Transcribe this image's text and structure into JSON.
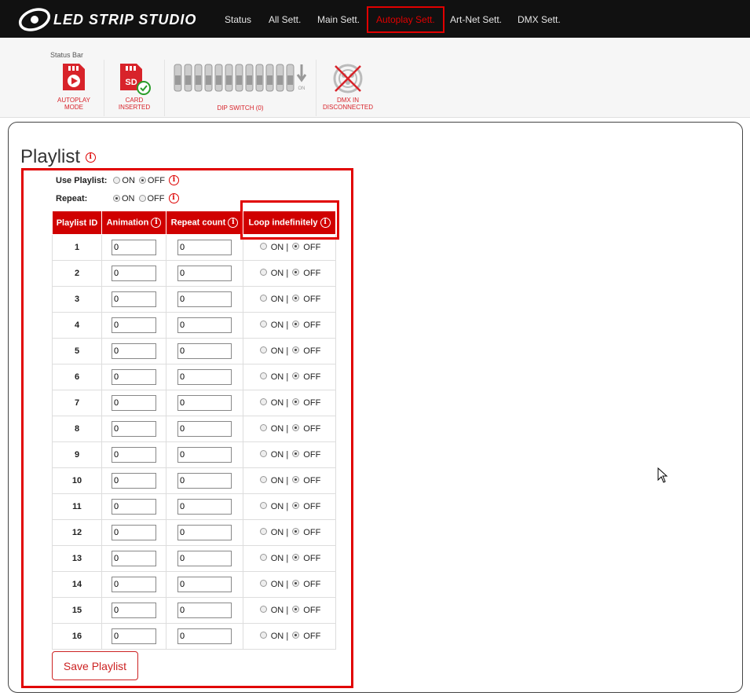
{
  "app": {
    "brand": "LED STRIP STUDIO"
  },
  "nav": {
    "items": [
      "Status",
      "All Sett.",
      "Main Sett.",
      "Autoplay Sett.",
      "Art-Net Sett.",
      "DMX Sett."
    ],
    "active": "Autoplay Sett."
  },
  "statusbar": {
    "title": "Status Bar",
    "autoplay": {
      "line1": "AUTOPLAY",
      "line2": "MODE"
    },
    "card": {
      "line1": "CARD",
      "line2": "INSERTED",
      "sd_text": "SD"
    },
    "dip": {
      "label": "DIP SWITCH (0)",
      "on_text": "ON"
    },
    "dmx": {
      "line1": "DMX IN",
      "line2": "DISCONNECTED"
    }
  },
  "panel": {
    "title": "Playlist",
    "use_playlist": {
      "label": "Use Playlist:",
      "on": "ON",
      "off": "OFF",
      "selected": "OFF"
    },
    "repeat": {
      "label": "Repeat:",
      "on": "ON",
      "off": "OFF",
      "selected": "ON"
    },
    "table": {
      "headers": [
        "Playlist ID",
        "Animation",
        "Repeat count",
        "Loop indefinitely"
      ],
      "loop_on": "ON",
      "loop_sep": "|",
      "loop_off": "OFF",
      "rows": [
        {
          "id": "1",
          "animation": "0",
          "repeat": "0",
          "loop": "OFF"
        },
        {
          "id": "2",
          "animation": "0",
          "repeat": "0",
          "loop": "OFF"
        },
        {
          "id": "3",
          "animation": "0",
          "repeat": "0",
          "loop": "OFF"
        },
        {
          "id": "4",
          "animation": "0",
          "repeat": "0",
          "loop": "OFF"
        },
        {
          "id": "5",
          "animation": "0",
          "repeat": "0",
          "loop": "OFF"
        },
        {
          "id": "6",
          "animation": "0",
          "repeat": "0",
          "loop": "OFF"
        },
        {
          "id": "7",
          "animation": "0",
          "repeat": "0",
          "loop": "OFF"
        },
        {
          "id": "8",
          "animation": "0",
          "repeat": "0",
          "loop": "OFF"
        },
        {
          "id": "9",
          "animation": "0",
          "repeat": "0",
          "loop": "OFF"
        },
        {
          "id": "10",
          "animation": "0",
          "repeat": "0",
          "loop": "OFF"
        },
        {
          "id": "11",
          "animation": "0",
          "repeat": "0",
          "loop": "OFF"
        },
        {
          "id": "12",
          "animation": "0",
          "repeat": "0",
          "loop": "OFF"
        },
        {
          "id": "13",
          "animation": "0",
          "repeat": "0",
          "loop": "OFF"
        },
        {
          "id": "14",
          "animation": "0",
          "repeat": "0",
          "loop": "OFF"
        },
        {
          "id": "15",
          "animation": "0",
          "repeat": "0",
          "loop": "OFF"
        },
        {
          "id": "16",
          "animation": "0",
          "repeat": "0",
          "loop": "OFF"
        }
      ]
    },
    "save_label": "Save Playlist"
  },
  "colors": {
    "accent": "#d00000",
    "nav_bg": "#111111"
  }
}
